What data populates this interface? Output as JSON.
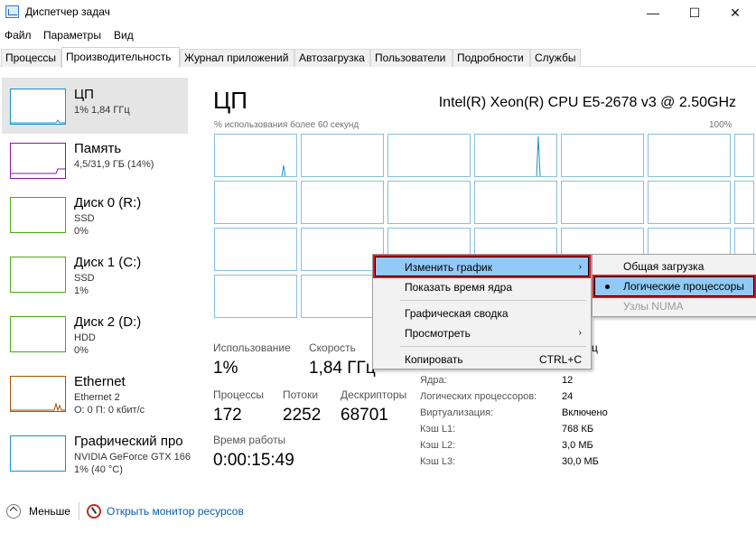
{
  "window": {
    "title": "Диспетчер задач",
    "minimize": "—",
    "maximize": "☐",
    "close": "✕"
  },
  "menu": [
    "Файл",
    "Параметры",
    "Вид"
  ],
  "tabs": [
    "Процессы",
    "Производительность",
    "Журнал приложений",
    "Автозагрузка",
    "Пользователи",
    "Подробности",
    "Службы"
  ],
  "active_tab": 1,
  "sidebar": [
    {
      "name": "ЦП",
      "lines": [
        "1% 1,84 ГГц"
      ],
      "color": "#1a91c9"
    },
    {
      "name": "Память",
      "lines": [
        "4,5/31,9 ГБ (14%)"
      ],
      "color": "#8b12ae"
    },
    {
      "name": "Диск 0 (R:)",
      "lines": [
        "SSD",
        "0%"
      ],
      "color": "#4da70f"
    },
    {
      "name": "Диск 1 (C:)",
      "lines": [
        "SSD",
        "1%"
      ],
      "color": "#4da70f"
    },
    {
      "name": "Диск 2 (D:)",
      "lines": [
        "HDD",
        "0%"
      ],
      "color": "#4da70f"
    },
    {
      "name": "Ethernet",
      "lines": [
        "Ethernet 2",
        "О: 0 П: 0 кбит/с"
      ],
      "color": "#a74f01"
    },
    {
      "name": "Графический про",
      "lines": [
        "NVIDIA GeForce GTX 166",
        "1% (40 °C)"
      ],
      "color": "#1a91c9"
    }
  ],
  "main": {
    "title": "ЦП",
    "cpu_model": "Intel(R) Xeon(R) CPU E5-2678 v3 @ 2.50GHz",
    "graph_label": "% использования более 60 секунд",
    "graph_max": "100%",
    "usage_label": "Использование",
    "usage": "1%",
    "speed_label": "Скорость",
    "speed": "1,84 ГГц",
    "processes_label": "Процессы",
    "processes": "172",
    "threads_label": "Потоки",
    "threads": "2252",
    "handles_label": "Дескрипторы",
    "handles": "68701",
    "uptime_label": "Время работы",
    "uptime": "0:00:15:49",
    "details": [
      {
        "k": "Ядра:",
        "v": "12"
      },
      {
        "k": "Логических процессоров:",
        "v": "24"
      },
      {
        "k": "Виртуализация:",
        "v": "Включено"
      },
      {
        "k": "Кэш L1:",
        "v": "768 КБ"
      },
      {
        "k": "Кэш L2:",
        "v": "3,0 МБ"
      },
      {
        "k": "Кэш L3:",
        "v": "30,0 МБ"
      }
    ],
    "partial_header": "ц"
  },
  "context_menu": {
    "change_graph": "Изменить график",
    "show_kernel": "Показать время ядра",
    "summary": "Графическая сводка",
    "view": "Просмотреть",
    "copy": "Копировать",
    "copy_shortcut": "CTRL+C",
    "arrow": "›"
  },
  "submenu": {
    "overall": "Общая загрузка",
    "logical": "Логические процессоры",
    "numa": "Узлы NUMA"
  },
  "footer": {
    "less": "Меньше",
    "monitor": "Открыть монитор ресурсов"
  }
}
